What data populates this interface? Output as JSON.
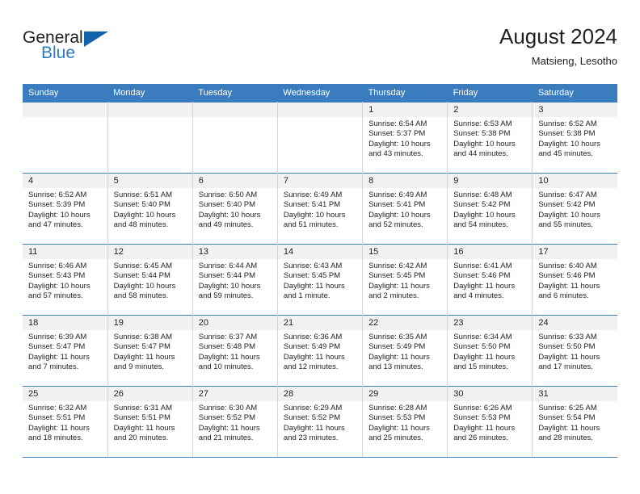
{
  "brand": {
    "word_one": "General",
    "word_two": "Blue",
    "triangle_color": "#1063a8",
    "blue_color": "#2b7dc2"
  },
  "header": {
    "title": "August 2024",
    "subtitle": "Matsieng, Lesotho"
  },
  "theme": {
    "header_blue": "#3a7cbe",
    "daynum_band": "#f1f1f1",
    "cell_border": "#d4d4d4",
    "text": "#231f20"
  },
  "weekdays": [
    "Sunday",
    "Monday",
    "Tuesday",
    "Wednesday",
    "Thursday",
    "Friday",
    "Saturday"
  ],
  "weeks": [
    [
      {
        "day": "",
        "empty": true,
        "sunrise": "",
        "sunset": "",
        "daylight_line1": "",
        "daylight_line2": ""
      },
      {
        "day": "",
        "empty": true,
        "sunrise": "",
        "sunset": "",
        "daylight_line1": "",
        "daylight_line2": ""
      },
      {
        "day": "",
        "empty": true,
        "sunrise": "",
        "sunset": "",
        "daylight_line1": "",
        "daylight_line2": ""
      },
      {
        "day": "",
        "empty": true,
        "sunrise": "",
        "sunset": "",
        "daylight_line1": "",
        "daylight_line2": ""
      },
      {
        "day": "1",
        "empty": false,
        "sunrise": "Sunrise: 6:54 AM",
        "sunset": "Sunset: 5:37 PM",
        "daylight_line1": "Daylight: 10 hours",
        "daylight_line2": "and 43 minutes."
      },
      {
        "day": "2",
        "empty": false,
        "sunrise": "Sunrise: 6:53 AM",
        "sunset": "Sunset: 5:38 PM",
        "daylight_line1": "Daylight: 10 hours",
        "daylight_line2": "and 44 minutes."
      },
      {
        "day": "3",
        "empty": false,
        "sunrise": "Sunrise: 6:52 AM",
        "sunset": "Sunset: 5:38 PM",
        "daylight_line1": "Daylight: 10 hours",
        "daylight_line2": "and 45 minutes."
      }
    ],
    [
      {
        "day": "4",
        "empty": false,
        "sunrise": "Sunrise: 6:52 AM",
        "sunset": "Sunset: 5:39 PM",
        "daylight_line1": "Daylight: 10 hours",
        "daylight_line2": "and 47 minutes."
      },
      {
        "day": "5",
        "empty": false,
        "sunrise": "Sunrise: 6:51 AM",
        "sunset": "Sunset: 5:40 PM",
        "daylight_line1": "Daylight: 10 hours",
        "daylight_line2": "and 48 minutes."
      },
      {
        "day": "6",
        "empty": false,
        "sunrise": "Sunrise: 6:50 AM",
        "sunset": "Sunset: 5:40 PM",
        "daylight_line1": "Daylight: 10 hours",
        "daylight_line2": "and 49 minutes."
      },
      {
        "day": "7",
        "empty": false,
        "sunrise": "Sunrise: 6:49 AM",
        "sunset": "Sunset: 5:41 PM",
        "daylight_line1": "Daylight: 10 hours",
        "daylight_line2": "and 51 minutes."
      },
      {
        "day": "8",
        "empty": false,
        "sunrise": "Sunrise: 6:49 AM",
        "sunset": "Sunset: 5:41 PM",
        "daylight_line1": "Daylight: 10 hours",
        "daylight_line2": "and 52 minutes."
      },
      {
        "day": "9",
        "empty": false,
        "sunrise": "Sunrise: 6:48 AM",
        "sunset": "Sunset: 5:42 PM",
        "daylight_line1": "Daylight: 10 hours",
        "daylight_line2": "and 54 minutes."
      },
      {
        "day": "10",
        "empty": false,
        "sunrise": "Sunrise: 6:47 AM",
        "sunset": "Sunset: 5:42 PM",
        "daylight_line1": "Daylight: 10 hours",
        "daylight_line2": "and 55 minutes."
      }
    ],
    [
      {
        "day": "11",
        "empty": false,
        "sunrise": "Sunrise: 6:46 AM",
        "sunset": "Sunset: 5:43 PM",
        "daylight_line1": "Daylight: 10 hours",
        "daylight_line2": "and 57 minutes."
      },
      {
        "day": "12",
        "empty": false,
        "sunrise": "Sunrise: 6:45 AM",
        "sunset": "Sunset: 5:44 PM",
        "daylight_line1": "Daylight: 10 hours",
        "daylight_line2": "and 58 minutes."
      },
      {
        "day": "13",
        "empty": false,
        "sunrise": "Sunrise: 6:44 AM",
        "sunset": "Sunset: 5:44 PM",
        "daylight_line1": "Daylight: 10 hours",
        "daylight_line2": "and 59 minutes."
      },
      {
        "day": "14",
        "empty": false,
        "sunrise": "Sunrise: 6:43 AM",
        "sunset": "Sunset: 5:45 PM",
        "daylight_line1": "Daylight: 11 hours",
        "daylight_line2": "and 1 minute."
      },
      {
        "day": "15",
        "empty": false,
        "sunrise": "Sunrise: 6:42 AM",
        "sunset": "Sunset: 5:45 PM",
        "daylight_line1": "Daylight: 11 hours",
        "daylight_line2": "and 2 minutes."
      },
      {
        "day": "16",
        "empty": false,
        "sunrise": "Sunrise: 6:41 AM",
        "sunset": "Sunset: 5:46 PM",
        "daylight_line1": "Daylight: 11 hours",
        "daylight_line2": "and 4 minutes."
      },
      {
        "day": "17",
        "empty": false,
        "sunrise": "Sunrise: 6:40 AM",
        "sunset": "Sunset: 5:46 PM",
        "daylight_line1": "Daylight: 11 hours",
        "daylight_line2": "and 6 minutes."
      }
    ],
    [
      {
        "day": "18",
        "empty": false,
        "sunrise": "Sunrise: 6:39 AM",
        "sunset": "Sunset: 5:47 PM",
        "daylight_line1": "Daylight: 11 hours",
        "daylight_line2": "and 7 minutes."
      },
      {
        "day": "19",
        "empty": false,
        "sunrise": "Sunrise: 6:38 AM",
        "sunset": "Sunset: 5:47 PM",
        "daylight_line1": "Daylight: 11 hours",
        "daylight_line2": "and 9 minutes."
      },
      {
        "day": "20",
        "empty": false,
        "sunrise": "Sunrise: 6:37 AM",
        "sunset": "Sunset: 5:48 PM",
        "daylight_line1": "Daylight: 11 hours",
        "daylight_line2": "and 10 minutes."
      },
      {
        "day": "21",
        "empty": false,
        "sunrise": "Sunrise: 6:36 AM",
        "sunset": "Sunset: 5:49 PM",
        "daylight_line1": "Daylight: 11 hours",
        "daylight_line2": "and 12 minutes."
      },
      {
        "day": "22",
        "empty": false,
        "sunrise": "Sunrise: 6:35 AM",
        "sunset": "Sunset: 5:49 PM",
        "daylight_line1": "Daylight: 11 hours",
        "daylight_line2": "and 13 minutes."
      },
      {
        "day": "23",
        "empty": false,
        "sunrise": "Sunrise: 6:34 AM",
        "sunset": "Sunset: 5:50 PM",
        "daylight_line1": "Daylight: 11 hours",
        "daylight_line2": "and 15 minutes."
      },
      {
        "day": "24",
        "empty": false,
        "sunrise": "Sunrise: 6:33 AM",
        "sunset": "Sunset: 5:50 PM",
        "daylight_line1": "Daylight: 11 hours",
        "daylight_line2": "and 17 minutes."
      }
    ],
    [
      {
        "day": "25",
        "empty": false,
        "sunrise": "Sunrise: 6:32 AM",
        "sunset": "Sunset: 5:51 PM",
        "daylight_line1": "Daylight: 11 hours",
        "daylight_line2": "and 18 minutes."
      },
      {
        "day": "26",
        "empty": false,
        "sunrise": "Sunrise: 6:31 AM",
        "sunset": "Sunset: 5:51 PM",
        "daylight_line1": "Daylight: 11 hours",
        "daylight_line2": "and 20 minutes."
      },
      {
        "day": "27",
        "empty": false,
        "sunrise": "Sunrise: 6:30 AM",
        "sunset": "Sunset: 5:52 PM",
        "daylight_line1": "Daylight: 11 hours",
        "daylight_line2": "and 21 minutes."
      },
      {
        "day": "28",
        "empty": false,
        "sunrise": "Sunrise: 6:29 AM",
        "sunset": "Sunset: 5:52 PM",
        "daylight_line1": "Daylight: 11 hours",
        "daylight_line2": "and 23 minutes."
      },
      {
        "day": "29",
        "empty": false,
        "sunrise": "Sunrise: 6:28 AM",
        "sunset": "Sunset: 5:53 PM",
        "daylight_line1": "Daylight: 11 hours",
        "daylight_line2": "and 25 minutes."
      },
      {
        "day": "30",
        "empty": false,
        "sunrise": "Sunrise: 6:26 AM",
        "sunset": "Sunset: 5:53 PM",
        "daylight_line1": "Daylight: 11 hours",
        "daylight_line2": "and 26 minutes."
      },
      {
        "day": "31",
        "empty": false,
        "sunrise": "Sunrise: 6:25 AM",
        "sunset": "Sunset: 5:54 PM",
        "daylight_line1": "Daylight: 11 hours",
        "daylight_line2": "and 28 minutes."
      }
    ]
  ]
}
